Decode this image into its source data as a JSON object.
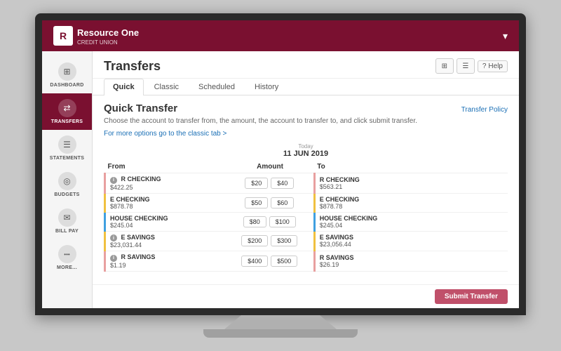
{
  "topNav": {
    "logoLetter": "R",
    "logoName": "Resource One",
    "logoSub": "CREDIT UNION",
    "chevron": "▾"
  },
  "sidebar": {
    "items": [
      {
        "id": "dashboard",
        "label": "DASHBOARD",
        "icon": "⊞",
        "active": false
      },
      {
        "id": "transfers",
        "label": "TRANSFERS",
        "icon": "⇄",
        "active": true
      },
      {
        "id": "statements",
        "label": "STATEMENTS",
        "icon": "☰",
        "active": false
      },
      {
        "id": "budgets",
        "label": "BUDGETS",
        "icon": "◎",
        "active": false
      },
      {
        "id": "billpay",
        "label": "BILL PAY",
        "icon": "✉",
        "active": false
      },
      {
        "id": "more",
        "label": "MORE...",
        "icon": "•••",
        "active": false
      }
    ]
  },
  "page": {
    "title": "Transfers",
    "tabs": [
      {
        "id": "quick",
        "label": "Quick",
        "active": true
      },
      {
        "id": "classic",
        "label": "Classic",
        "active": false
      },
      {
        "id": "scheduled",
        "label": "Scheduled",
        "active": false
      },
      {
        "id": "history",
        "label": "History",
        "active": false
      }
    ]
  },
  "quickTransfer": {
    "sectionTitle": "Quick Transfer",
    "policyLink": "Transfer Policy",
    "description": "Choose the account to transfer from, the amount, the account to transfer to, and click submit transfer.",
    "classicLink": "For more options go to the classic tab >",
    "dateLabel": "Today",
    "dateValue": "11 JUN 2019",
    "columns": {
      "from": "From",
      "amount": "Amount",
      "to": "To"
    },
    "accounts": [
      {
        "id": "r-checking",
        "name": "R CHECKING",
        "fromBalance": "$422.25",
        "toBalance": "$563.21",
        "hasInfo": true,
        "colorClass": "left-border-r",
        "amounts": [
          "$20",
          "$40"
        ]
      },
      {
        "id": "e-checking",
        "name": "E CHECKING",
        "fromBalance": "$878.78",
        "toBalance": "$878.78",
        "hasInfo": false,
        "colorClass": "left-border-e",
        "amounts": [
          "$50",
          "$60"
        ]
      },
      {
        "id": "house-checking",
        "name": "HOUSE CHECKING",
        "fromBalance": "$245.04",
        "toBalance": "$245.04",
        "hasInfo": false,
        "colorClass": "left-border-h",
        "amounts": [
          "$80",
          "$100"
        ]
      },
      {
        "id": "e-savings",
        "name": "E SAVINGS",
        "fromBalance": "$23,031.44",
        "toBalance": "$23,056.44",
        "hasInfo": true,
        "colorClass": "left-border-es",
        "amounts": [
          "$200",
          "$300"
        ]
      },
      {
        "id": "r-savings",
        "name": "R SAVINGS",
        "fromBalance": "$1.19",
        "toBalance": "$26.19",
        "hasInfo": true,
        "colorClass": "left-border-rs",
        "amounts": [
          "$400",
          "$500"
        ]
      }
    ],
    "submitLabel": "Submit Transfer"
  },
  "helpLabel": "Help"
}
